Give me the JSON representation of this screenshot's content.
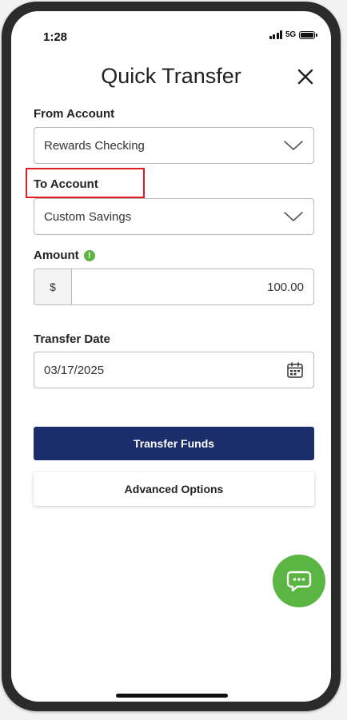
{
  "status_bar": {
    "time": "1:28",
    "network": "5G",
    "network_icon": "signal-bars-icon",
    "battery_icon": "battery-icon"
  },
  "header": {
    "title": "Quick Transfer",
    "close_icon": "close-icon"
  },
  "form": {
    "from_account": {
      "label": "From Account",
      "value": "Rewards Checking",
      "icon": "chevron-down-icon"
    },
    "to_account": {
      "label": "To Account",
      "value": "Custom Savings",
      "icon": "chevron-down-icon",
      "highlight_color": "#e01b24"
    },
    "amount": {
      "label": "Amount",
      "info_icon": "info-icon",
      "info_glyph": "!",
      "currency_symbol": "$",
      "value": "100.00"
    },
    "transfer_date": {
      "label": "Transfer Date",
      "value": "03/17/2025",
      "icon": "calendar-icon"
    }
  },
  "actions": {
    "primary_label": "Transfer Funds",
    "secondary_label": "Advanced Options"
  },
  "chat": {
    "icon": "chat-bubble-icon"
  },
  "colors": {
    "primary_button": "#1b2d6b",
    "accent_green": "#5bb543",
    "highlight_red": "#e01b24"
  }
}
